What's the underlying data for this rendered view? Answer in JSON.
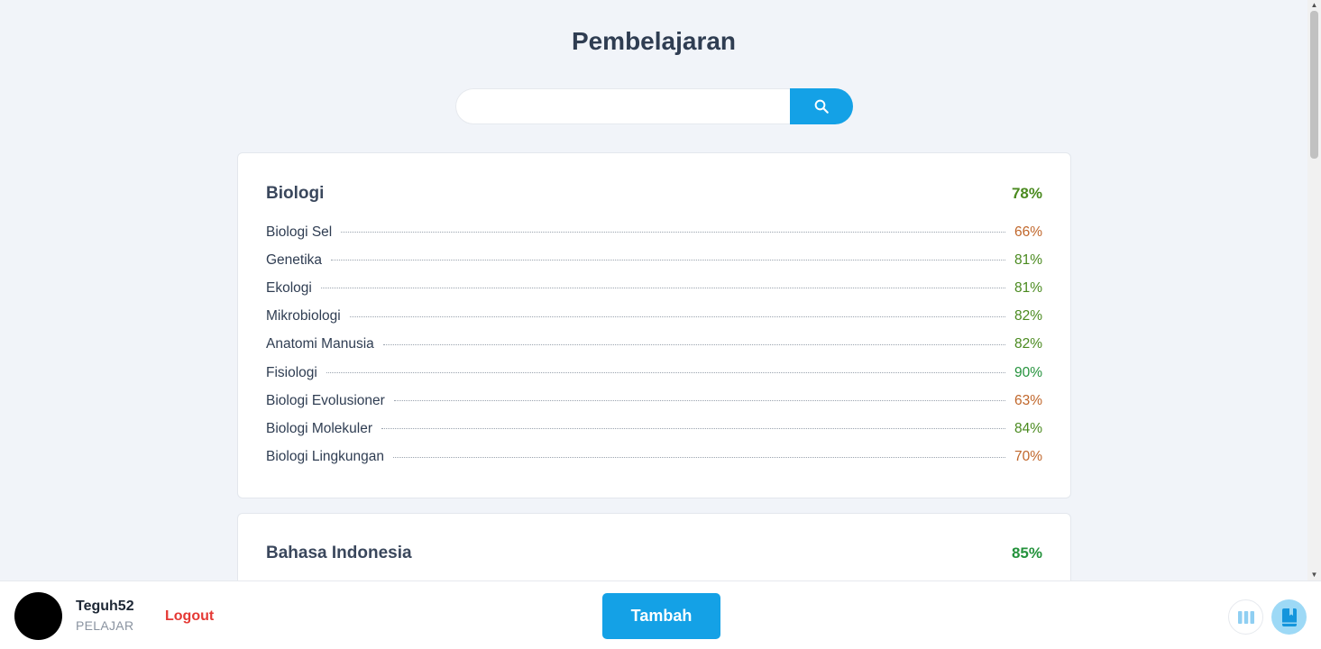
{
  "header": {
    "title": "Pembelajaran"
  },
  "search": {
    "value": "",
    "placeholder": ""
  },
  "subjects": [
    {
      "name": "Biologi",
      "percent": "78%",
      "color": "#4a8a1f",
      "topics": [
        {
          "name": "Biologi Sel",
          "percent": "66%",
          "color": "#c0662a"
        },
        {
          "name": "Genetika",
          "percent": "81%",
          "color": "#4a8a1f"
        },
        {
          "name": "Ekologi",
          "percent": "81%",
          "color": "#4a8a1f"
        },
        {
          "name": "Mikrobiologi",
          "percent": "82%",
          "color": "#4a8a1f"
        },
        {
          "name": "Anatomi Manusia",
          "percent": "82%",
          "color": "#4a8a1f"
        },
        {
          "name": "Fisiologi",
          "percent": "90%",
          "color": "#24923c"
        },
        {
          "name": "Biologi Evolusioner",
          "percent": "63%",
          "color": "#c0662a"
        },
        {
          "name": "Biologi Molekuler",
          "percent": "84%",
          "color": "#4a8a1f"
        },
        {
          "name": "Biologi Lingkungan",
          "percent": "70%",
          "color": "#c0662a"
        }
      ]
    },
    {
      "name": "Bahasa Indonesia",
      "percent": "85%",
      "color": "#24923c",
      "topics": []
    }
  ],
  "footer": {
    "username": "Teguh52",
    "role": "PELAJAR",
    "logout_label": "Logout",
    "add_label": "Tambah",
    "icons": {
      "list": "columns-icon",
      "book": "book-icon"
    }
  }
}
